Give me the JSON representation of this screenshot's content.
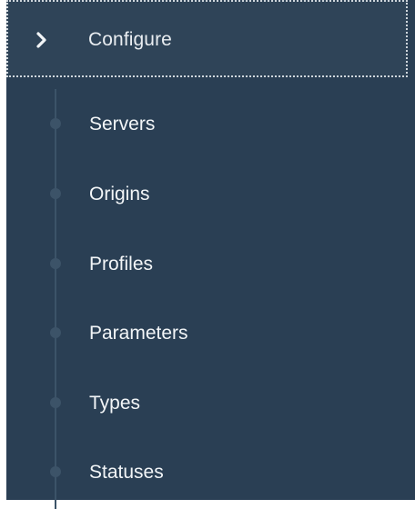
{
  "menu": {
    "header": {
      "label": "Configure",
      "icon": "chevron-right-icon",
      "expanded": true
    },
    "items": [
      {
        "label": "Servers"
      },
      {
        "label": "Origins"
      },
      {
        "label": "Profiles"
      },
      {
        "label": "Parameters"
      },
      {
        "label": "Types"
      },
      {
        "label": "Statuses"
      }
    ]
  },
  "colors": {
    "sidebar_bg": "#2a3f54",
    "header_bg": "#2f4458",
    "text": "#f2f5f7",
    "timeline": "#3c5368"
  }
}
